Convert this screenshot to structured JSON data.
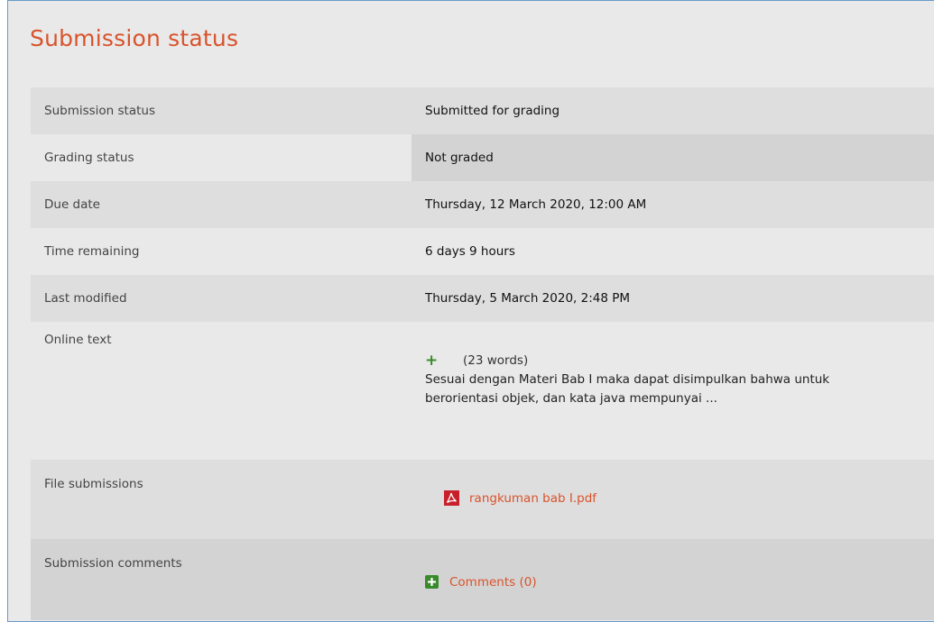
{
  "heading": "Submission status",
  "rows": {
    "submission_status": {
      "label": "Submission status",
      "value": "Submitted for grading"
    },
    "grading_status": {
      "label": "Grading status",
      "value": "Not graded"
    },
    "due_date": {
      "label": "Due date",
      "value": "Thursday, 12 March 2020, 12:00 AM"
    },
    "time_remaining": {
      "label": "Time remaining",
      "value": "6 days 9 hours"
    },
    "last_modified": {
      "label": "Last modified",
      "value": "Thursday, 5 March 2020, 2:48 PM"
    },
    "online_text": {
      "label": "Online text",
      "word_count": "(23 words)",
      "line1": "Sesuai dengan Materi Bab I maka dapat disimpulkan bahwa untuk",
      "line2": "berorientasi objek, dan kata java mempunyai ..."
    },
    "file_submissions": {
      "label": "File submissions",
      "file_name": "rangkuman bab I.pdf"
    },
    "submission_comments": {
      "label": "Submission comments",
      "link": "Comments (0)"
    }
  },
  "icons": {
    "expand": "plus-icon",
    "file": "pdf-icon",
    "comments": "add-box-icon"
  },
  "colors": {
    "accent": "#d9532c",
    "success_icon": "#3a8a2c",
    "pdf_icon": "#c8202a",
    "frame_border": "#6a9bc9"
  }
}
